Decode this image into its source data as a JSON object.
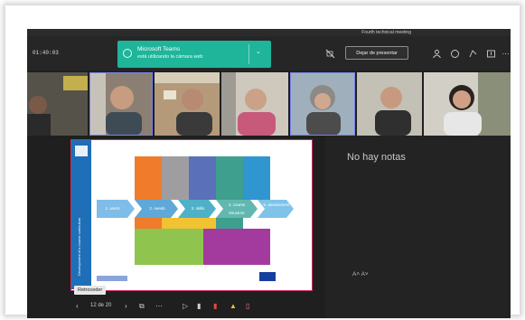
{
  "window": {
    "title": "Fourth technical meeting"
  },
  "toolbar": {
    "timer": "01:40:03",
    "present_button": "Dejar de presentar"
  },
  "toast": {
    "title": "Microsoft Teams",
    "subtitle": "está utilizando la cámara web"
  },
  "participants": [
    {
      "id": "p1",
      "speaking": false
    },
    {
      "id": "p2",
      "speaking": true
    },
    {
      "id": "p3",
      "speaking": false
    },
    {
      "id": "p4",
      "speaking": false
    },
    {
      "id": "p5",
      "speaking": true
    },
    {
      "id": "p6",
      "speaking": false
    },
    {
      "id": "p7",
      "speaking": false
    }
  ],
  "notes": {
    "empty_text": "No hay notas",
    "font_controls": "A˄  A˅"
  },
  "presenter_bar": {
    "page_counter": "12 de 20",
    "tooltip": "Retroceder"
  },
  "slide": {
    "steps": [
      "1. users",
      "2. needs",
      "3. skills",
      "4. course structure",
      "5. assessment"
    ]
  },
  "colors": {
    "accent": "#7b83eb",
    "toast": "#1fb59a",
    "slide_border": "#cc2b5e"
  }
}
